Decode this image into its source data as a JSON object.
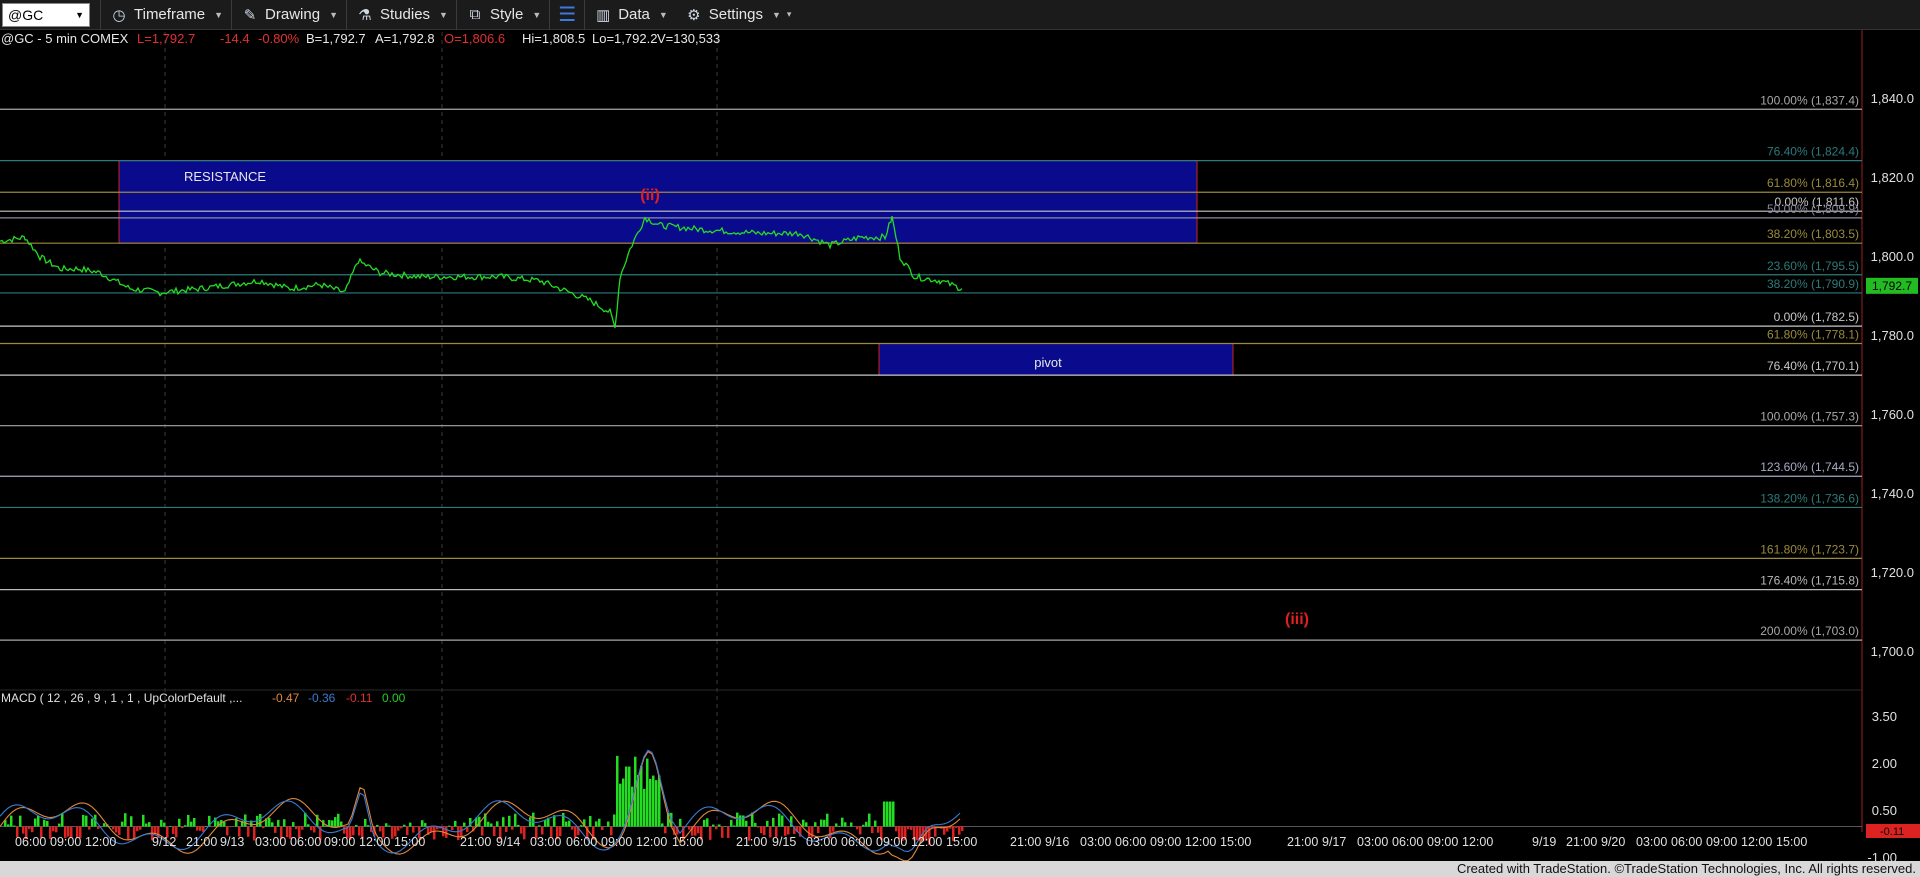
{
  "toolbar": {
    "symbol": "@GC",
    "timeframe": "Timeframe",
    "drawing": "Drawing",
    "studies": "Studies",
    "style": "Style",
    "data": "Data",
    "settings": "Settings"
  },
  "header": {
    "symbol": "@GC - 5 min  COMEX",
    "last": "L=1,792.7",
    "change": "-14.4",
    "change_pct": "-0.80%",
    "bid": "B=1,792.7",
    "ask": "A=1,792.8",
    "open": "O=1,806.6",
    "high": "Hi=1,808.5",
    "low": "Lo=1,792.2",
    "volume": "V=130,533"
  },
  "colors": {
    "price_line": "#22dd22",
    "zone_fill": "#0a0a8c",
    "zone_border": "#cc2222",
    "wave_label": "#dd2020",
    "last_price_bg": "#22bb22"
  },
  "price_axis": {
    "labels": [
      "1,840.0",
      "1,820.0",
      "1,800.0",
      "1,780.0",
      "1,760.0",
      "1,740.0",
      "1,720.0",
      "1,700.0"
    ],
    "values": [
      1840,
      1820,
      1800,
      1780,
      1760,
      1740,
      1720,
      1700
    ],
    "last_price": "1,792.7"
  },
  "fib_levels": [
    {
      "label": "100.00% (1,837.4)",
      "value": 1837.4,
      "color": "#a8a8a8"
    },
    {
      "label": "76.40% (1,824.4)",
      "value": 1824.4,
      "color": "#2c7a7a"
    },
    {
      "label": "61.80% (1,816.4)",
      "value": 1816.4,
      "color": "#9a8a3a"
    },
    {
      "label": "0.00% (1,811.6)",
      "value": 1811.6,
      "color": "#c8c8c8"
    },
    {
      "label": "50.00% (1,809.9)",
      "value": 1809.9,
      "color": "#8a8aa0"
    },
    {
      "label": "38.20% (1,803.5)",
      "value": 1803.5,
      "color": "#9a8a3a"
    },
    {
      "label": "23.60% (1,795.5)",
      "value": 1795.5,
      "color": "#2c7a7a"
    },
    {
      "label": "38.20% (1,790.9)",
      "value": 1790.9,
      "color": "#2c7a7a"
    },
    {
      "label": "0.00% (1,782.5)",
      "value": 1782.5,
      "color": "#c8c8c8"
    },
    {
      "label": "61.80% (1,778.1)",
      "value": 1778.1,
      "color": "#9a8a3a"
    },
    {
      "label": "76.40% (1,770.1)",
      "value": 1770.1,
      "color": "#c8c8c8"
    },
    {
      "label": "100.00% (1,757.3)",
      "value": 1757.3,
      "color": "#a8a8a8"
    },
    {
      "label": "123.60% (1,744.5)",
      "value": 1744.5,
      "color": "#a8a8c8"
    },
    {
      "label": "138.20% (1,736.6)",
      "value": 1736.6,
      "color": "#2c7a7a"
    },
    {
      "label": "161.80% (1,723.7)",
      "value": 1723.7,
      "color": "#9a8a3a"
    },
    {
      "label": "176.40% (1,715.8)",
      "value": 1715.8,
      "color": "#b8b8b8"
    },
    {
      "label": "200.00% (1,703.0)",
      "value": 1703.0,
      "color": "#a8a8a8"
    }
  ],
  "zones": [
    {
      "label": "RESISTANCE",
      "top": 1824.4,
      "bottom": 1803.5
    },
    {
      "label": "pivot",
      "top": 1778.1,
      "bottom": 1770.1
    }
  ],
  "wave_labels": [
    "(ii)",
    "(iii)"
  ],
  "macd": {
    "title": "MACD ( 12 , 26 , 9 , 1 , 1 , UpColorDefault ,...",
    "v1": "-0.47",
    "v2": "-0.36",
    "v3": "-0.11",
    "v4": "0.00",
    "axis_labels": [
      "3.50",
      "2.00",
      "0.50",
      "-1.00"
    ],
    "axis_values": [
      3.5,
      2.0,
      0.5,
      -1.0
    ],
    "current": "-0.11"
  },
  "time_axis": [
    "06:00",
    "09:00",
    "12:00",
    "9/12",
    "21:00",
    "9/13",
    "03:00",
    "06:00",
    "09:00",
    "12:00",
    "15:00",
    "21:00",
    "9/14",
    "03:00",
    "06:00",
    "09:00",
    "12:00",
    "15:00",
    "21:00",
    "9/15",
    "03:00",
    "06:00",
    "09:00",
    "12:00",
    "15:00",
    "21:00",
    "9/16",
    "03:00",
    "06:00",
    "09:00",
    "12:00",
    "15:00",
    "21:00",
    "9/17",
    "03:00",
    "06:00",
    "09:00",
    "12:00",
    "9/19",
    "21:00",
    "9/20",
    "03:00",
    "06:00",
    "09:00",
    "12:00",
    "15:00"
  ],
  "footer": "Created with TradeStation. ©TradeStation Technologies, Inc. All rights reserved."
}
